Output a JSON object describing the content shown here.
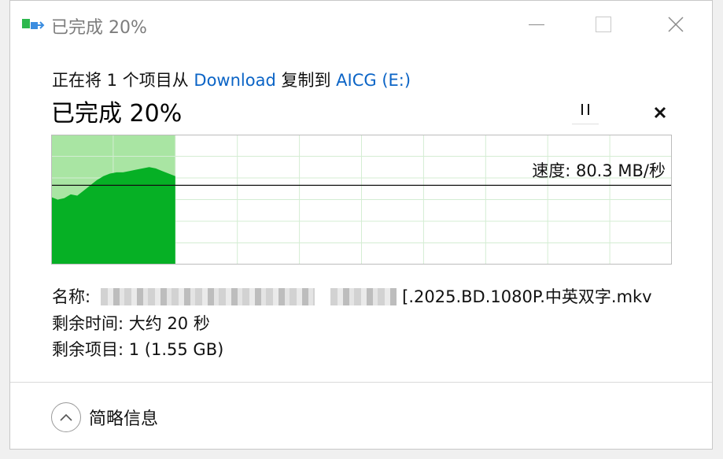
{
  "window": {
    "title": "已完成 20%",
    "controls": {
      "minimize": "minimize",
      "maximize": "maximize",
      "close": "close"
    }
  },
  "copy": {
    "prefix": "正在将 1 个项目从",
    "source": "Download",
    "middle": "复制到",
    "destination": "AICG (E:)"
  },
  "progress": {
    "label": "已完成 20%",
    "fraction": 0.2
  },
  "graph": {
    "speed_label": "速度: 80.3 MB/秒",
    "speed_relative_level": 0.61,
    "throughput_profile": [
      0.52,
      0.5,
      0.51,
      0.54,
      0.53,
      0.57,
      0.61,
      0.65,
      0.68,
      0.7,
      0.71,
      0.71,
      0.72,
      0.73,
      0.74,
      0.75,
      0.74,
      0.72,
      0.7,
      0.68
    ],
    "colors": {
      "fill": "#06b025",
      "completed_bg": "#a9e5a3",
      "grid": "#d4edd3"
    }
  },
  "details": {
    "name_label": "名称:",
    "name_value": "[.2025.BD.1080P.中英双字.mkv",
    "time_label": "剩余时间:",
    "time_value": "大约 20 秒",
    "items_label": "剩余项目:",
    "items_value": "1 (1.55 GB)"
  },
  "footer": {
    "toggle_icon": "chevron-up-icon",
    "toggle_label": "简略信息"
  }
}
